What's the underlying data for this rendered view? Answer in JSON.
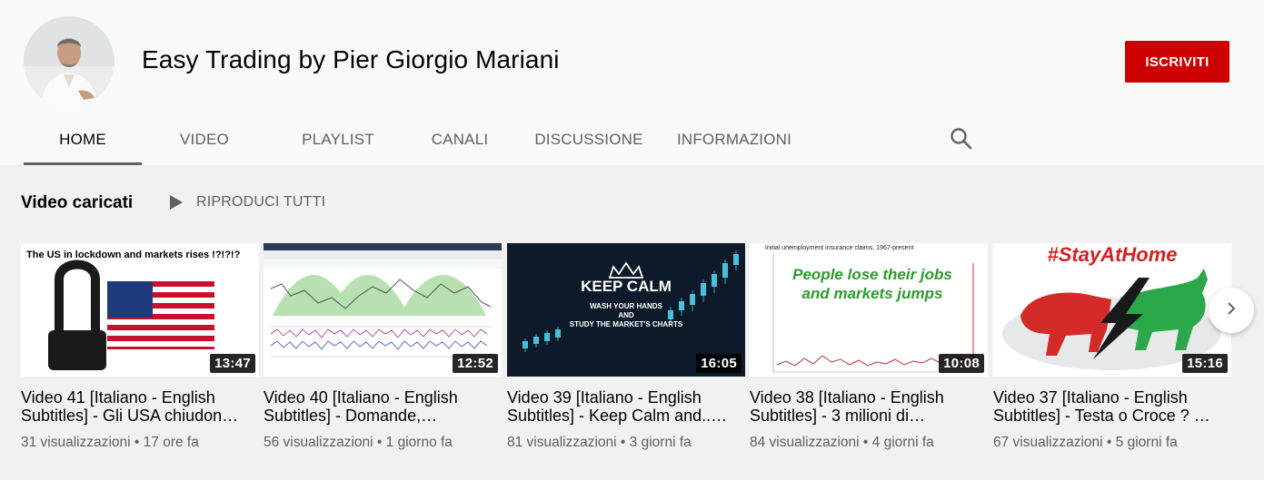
{
  "channel": {
    "name": "Easy Trading by Pier Giorgio Mariani",
    "subscribe_label": "ISCRIVITI",
    "brand_color": "#cc0000"
  },
  "tabs": [
    {
      "label": "HOME",
      "active": true
    },
    {
      "label": "VIDEO",
      "active": false
    },
    {
      "label": "PLAYLIST",
      "active": false
    },
    {
      "label": "CANALI",
      "active": false
    },
    {
      "label": "DISCUSSIONE",
      "active": false
    },
    {
      "label": "INFORMAZIONI",
      "active": false
    }
  ],
  "section": {
    "title": "Video caricati",
    "play_all": "RIPRODUCI TUTTI"
  },
  "videos": [
    {
      "thumb_text": "The US in lockdown and markets rises !?!?!?",
      "duration": "13:47",
      "title": "Video 41 [Italiano - English Subtitles] - Gli USA chiudon…",
      "views": "31 visualizzazioni",
      "age": "17 ore fa"
    },
    {
      "thumb_text": "",
      "duration": "12:52",
      "title": "Video 40 [Italiano - English Subtitles] - Domande,…",
      "views": "56 visualizzazioni",
      "age": "1 giorno fa"
    },
    {
      "thumb_text": "KEEP CALM",
      "thumb_text2": "WASH YOUR HANDS",
      "thumb_text3": "AND",
      "thumb_text4": "STUDY THE MARKET'S CHARTS",
      "duration": "16:05",
      "title": "Video 39 [Italiano - English Subtitles] - Keep Calm and..…",
      "views": "81 visualizzazioni",
      "age": "3 giorni fa"
    },
    {
      "thumb_text": "People lose their jobs and markets jumps",
      "thumb_caption": "Initial unemployment insurance claims, 1967-present",
      "duration": "10:08",
      "title": "Video 38 [Italiano - English Subtitles] - 3 milioni di…",
      "views": "84 visualizzazioni",
      "age": "4 giorni fa"
    },
    {
      "thumb_text": "#StayAtHome",
      "duration": "15:16",
      "title": "Video 37 [Italiano - English Subtitles] - Testa o Croce ? …",
      "views": "67 visualizzazioni",
      "age": "5 giorni fa"
    }
  ],
  "icons": {
    "search": "search-icon",
    "play": "play-icon",
    "next": "chevron-right-icon"
  }
}
